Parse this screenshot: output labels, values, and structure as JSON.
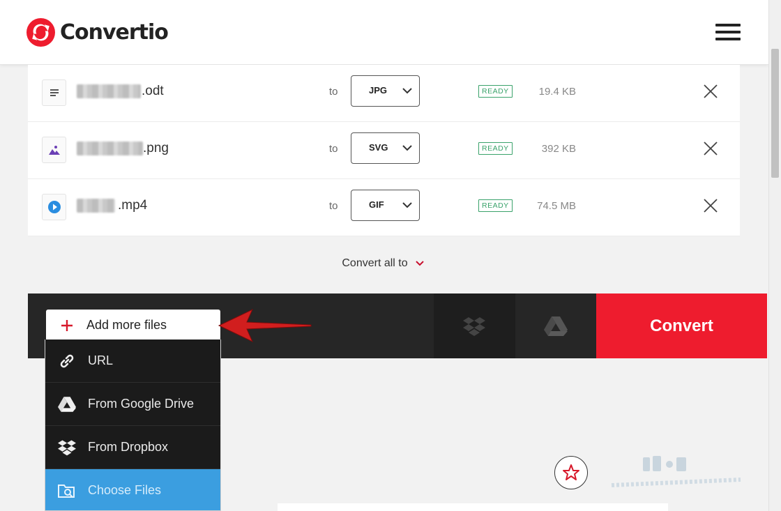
{
  "app": {
    "name": "Convertio",
    "brand_color": "#ee1c2e"
  },
  "files": [
    {
      "ext": ".odt",
      "icon": "document-icon",
      "to_label": "to",
      "format": "JPG",
      "status": "READY",
      "size": "19.4 KB"
    },
    {
      "ext": ".png",
      "icon": "image-icon",
      "to_label": "to",
      "format": "SVG",
      "status": "READY",
      "size": "392 KB"
    },
    {
      "ext": ".mp4",
      "icon": "video-play-icon",
      "to_label": "to",
      "format": "GIF",
      "status": "READY",
      "size": "74.5 MB"
    }
  ],
  "convert_all": {
    "label": "Convert all to"
  },
  "actions": {
    "add_more": "Add more files",
    "convert": "Convert"
  },
  "add_menu": [
    {
      "label": "URL",
      "icon": "link-icon"
    },
    {
      "label": "From Google Drive",
      "icon": "google-drive-icon"
    },
    {
      "label": "From Dropbox",
      "icon": "dropbox-icon"
    },
    {
      "label": "Choose Files",
      "icon": "folder-search-icon",
      "highlighted": true
    }
  ]
}
